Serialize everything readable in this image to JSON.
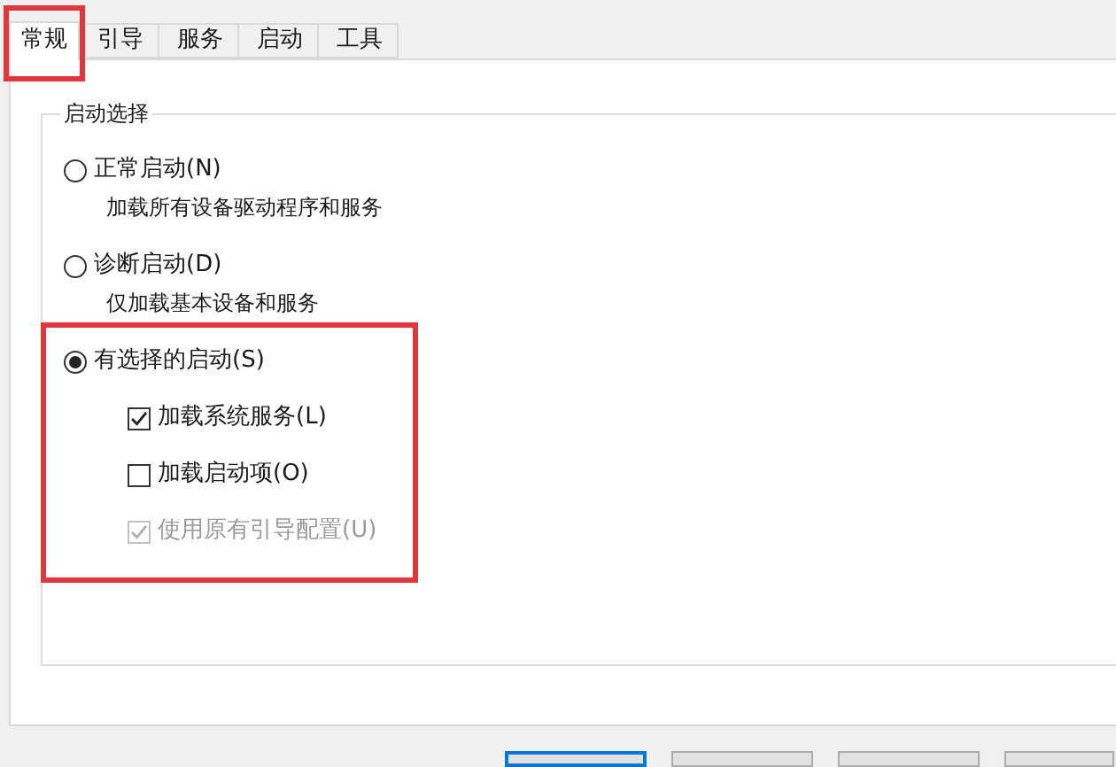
{
  "tabs": [
    {
      "label": "常规",
      "selected": true,
      "highlighted": true
    },
    {
      "label": "引导",
      "selected": false,
      "highlighted": false
    },
    {
      "label": "服务",
      "selected": false,
      "highlighted": false
    },
    {
      "label": "启动",
      "selected": false,
      "highlighted": false
    },
    {
      "label": "工具",
      "selected": false,
      "highlighted": false
    }
  ],
  "group": {
    "title": "启动选择",
    "options": [
      {
        "label": "正常启动(N)",
        "description": "加载所有设备驱动程序和服务",
        "selected": false,
        "highlighted": false
      },
      {
        "label": "诊断启动(D)",
        "description": "仅加载基本设备和服务",
        "selected": false,
        "highlighted": false
      },
      {
        "label": "有选择的启动(S)",
        "selected": true,
        "highlighted": true,
        "checkboxes": [
          {
            "label": "加载系统服务(L)",
            "checked": true,
            "disabled": false
          },
          {
            "label": "加载启动项(O)",
            "checked": false,
            "disabled": false
          },
          {
            "label": "使用原有引导配置(U)",
            "checked": true,
            "disabled": true
          }
        ]
      }
    ]
  },
  "buttons": [
    {
      "default": true
    },
    {
      "default": false
    },
    {
      "default": false
    },
    {
      "default": false
    }
  ]
}
